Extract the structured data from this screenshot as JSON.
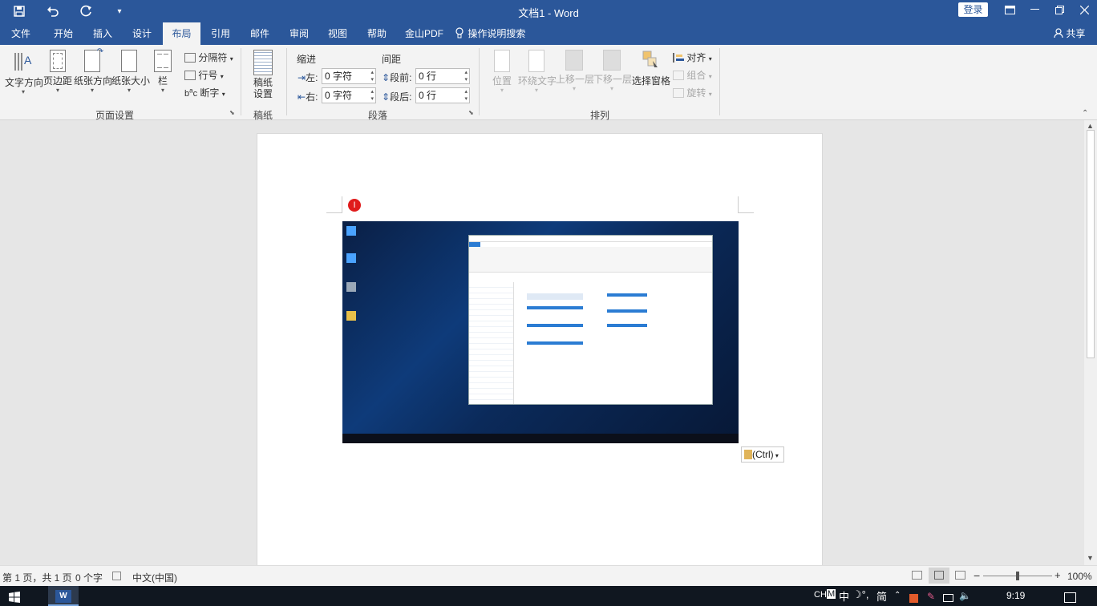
{
  "app": {
    "title": "文档1  -  Word",
    "login_label": "登录",
    "share_label": "共享"
  },
  "tabs": [
    {
      "label": "文件"
    },
    {
      "label": "开始"
    },
    {
      "label": "插入"
    },
    {
      "label": "设计"
    },
    {
      "label": "布局"
    },
    {
      "label": "引用"
    },
    {
      "label": "邮件"
    },
    {
      "label": "审阅"
    },
    {
      "label": "视图"
    },
    {
      "label": "帮助"
    },
    {
      "label": "金山PDF"
    }
  ],
  "tell_me": "操作说明搜索",
  "ribbon": {
    "page_setup": {
      "text_direction": "文字方向",
      "margins": "页边距",
      "orientation": "纸张方向",
      "size": "纸张大小",
      "columns": "栏",
      "breaks": "分隔符",
      "line_numbers": "行号",
      "hyphenation": "断字",
      "group_name": "页面设置"
    },
    "manuscript": {
      "button": "稿纸\n设置",
      "group_name": "稿纸"
    },
    "paragraph": {
      "indent_title": "缩进",
      "spacing_title": "间距",
      "left_label": "左:",
      "left_value": "0 字符",
      "right_label": "右:",
      "right_value": "0 字符",
      "before_label": "段前:",
      "before_value": "0 行",
      "after_label": "段后:",
      "after_value": "0 行",
      "group_name": "段落"
    },
    "arrange": {
      "position": "位置",
      "wrap_text": "环绕文字",
      "bring_forward": "上移一层",
      "send_backward": "下移一层",
      "selection_pane": "选择窗格",
      "align": "对齐",
      "group": "组合",
      "rotate": "旋转",
      "group_name": "排列"
    }
  },
  "document": {
    "paste_options": "(Ctrl)"
  },
  "status": {
    "page": "第 1 页，共 1 页",
    "words": "0 个字",
    "language": "中文(中国)",
    "zoom": "100%"
  },
  "taskbar": {
    "ime": "CH",
    "ime_mode": "中",
    "ime_extra": "简",
    "time": "9:19"
  },
  "colors": {
    "brand": "#2b579a",
    "ribbon_bg": "#f3f3f3"
  }
}
